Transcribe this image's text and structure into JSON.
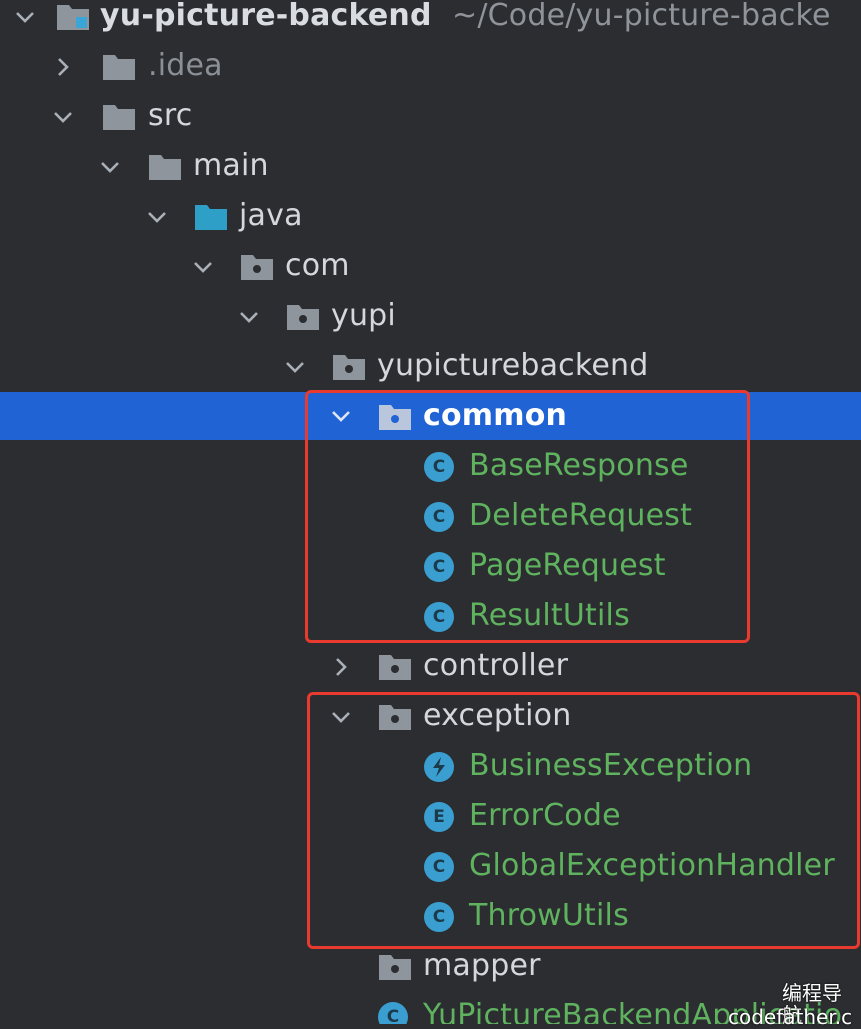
{
  "project": {
    "name": "yu-picture-backend",
    "path": "~/Code/yu-picture-backe"
  },
  "tree": {
    "idea": ".idea",
    "src": "src",
    "main": "main",
    "java": "java",
    "com": "com",
    "yupi": "yupi",
    "yupicturebackend": "yupicturebackend",
    "common": {
      "label": "common",
      "items": [
        "BaseResponse",
        "DeleteRequest",
        "PageRequest",
        "ResultUtils"
      ]
    },
    "controller": "controller",
    "exception": {
      "label": "exception",
      "items": [
        "BusinessException",
        "ErrorCode",
        "GlobalExceptionHandler",
        "ThrowUtils"
      ]
    },
    "mapper": "mapper",
    "application": "YuPictureBackendApplicatio"
  },
  "icons": {
    "class_letter": "C",
    "enum_letter": "E"
  },
  "watermark": {
    "line1": "编程导航",
    "line2": "codefather.c"
  },
  "colors": {
    "background": "#2b2d30",
    "selection": "#1f63d4",
    "class_text": "#5fb35f",
    "class_icon": "#3a9fd0",
    "highlight_box": "#e83a2e"
  }
}
